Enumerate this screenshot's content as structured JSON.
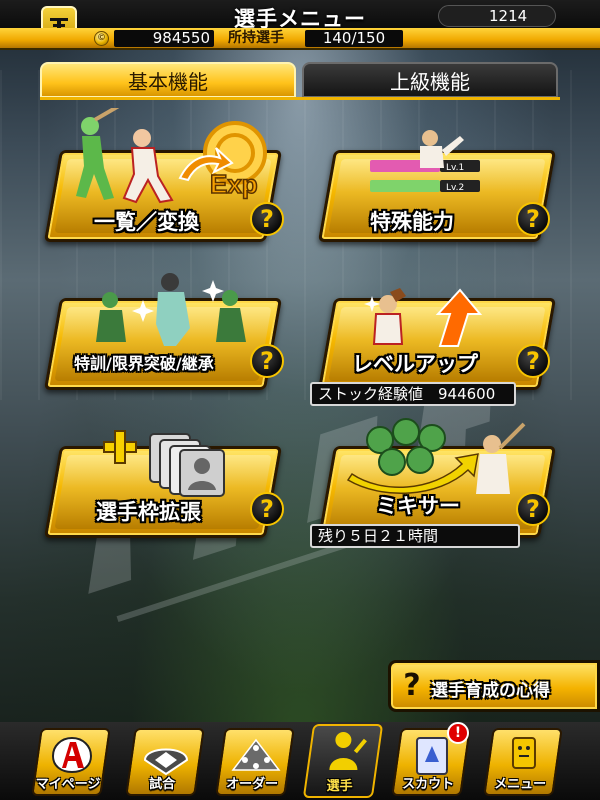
{
  "header": {
    "title": "選手メニュー",
    "coins": "984550",
    "owned_label": "所持選手",
    "owned_value": "140/150",
    "gems": "1214",
    "team_logo_icon": "tigers-logo-icon",
    "coin_icon": "coin-icon",
    "gem_icon": "golden-ball-icon"
  },
  "tabs": [
    {
      "label": "基本機能",
      "active": true
    },
    {
      "label": "上級機能",
      "active": false
    }
  ],
  "menu": {
    "list_convert": {
      "label": "一覧／変換",
      "art_text": "Exp"
    },
    "special_ability": {
      "label": "特殊能力",
      "lv1": "Lv.1",
      "lv2": "Lv.2"
    },
    "training": {
      "label": "特訓/限界突破/継承"
    },
    "level_up": {
      "label": "レベルアップ",
      "info": "ストック経験値　944600"
    },
    "slot_expand": {
      "label": "選手枠拡張"
    },
    "mixer": {
      "label": "ミキサー",
      "info": "残り５日２１時間"
    },
    "help_glyph": "?"
  },
  "guide": {
    "label": "選手育成の心得",
    "glyph": "?"
  },
  "nav": [
    {
      "label": "マイページ",
      "icon": "mypage-a-icon",
      "active": false
    },
    {
      "label": "試合",
      "icon": "stadium-icon",
      "active": false
    },
    {
      "label": "オーダー",
      "icon": "lineup-icon",
      "active": false
    },
    {
      "label": "選手",
      "icon": "player-icon",
      "active": true
    },
    {
      "label": "スカウト",
      "icon": "scout-card-icon",
      "active": false
    },
    {
      "label": "メニュー",
      "icon": "menu-character-icon",
      "active": false
    }
  ],
  "scout_badge": "!",
  "colors": {
    "accent": "#f6b800",
    "dark": "#0a0a0a",
    "badge": "#e00000"
  }
}
